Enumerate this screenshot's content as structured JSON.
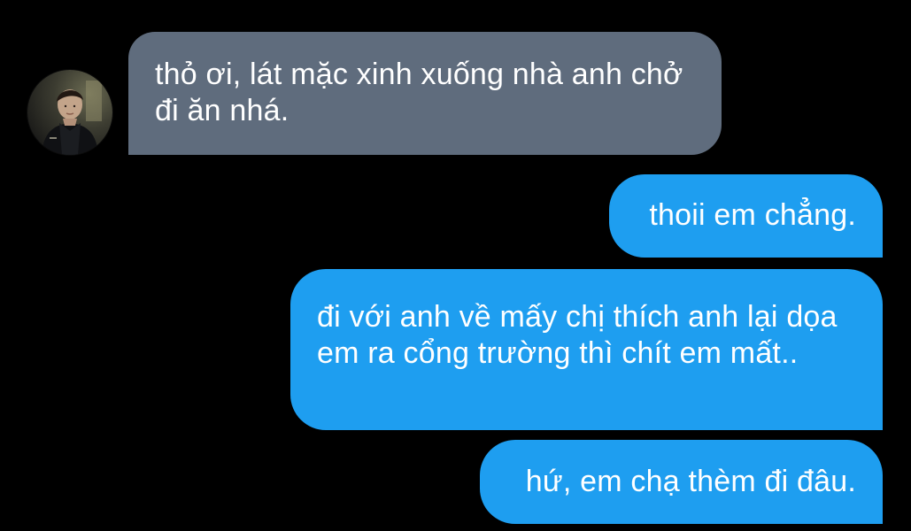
{
  "conversation": {
    "messages": [
      {
        "direction": "incoming",
        "text": "thỏ ơi, lát mặc xinh xuống nhà anh chở đi ăn nhá."
      },
      {
        "direction": "outgoing",
        "text": "thoii em chẳng."
      },
      {
        "direction": "outgoing",
        "text": "đi với anh về mấy chị thích anh lại dọa em ra cổng trường thì chít em mất.."
      },
      {
        "direction": "outgoing",
        "text": "hứ, em chạ thèm đi đâu."
      }
    ]
  },
  "theme": {
    "background": "#000000",
    "incoming_bubble_color": "#5f6c7d",
    "outgoing_bubble_color": "#1e9ef0",
    "text_color": "#ffffff"
  },
  "icons": {
    "avatar": "contact-avatar-photo"
  }
}
